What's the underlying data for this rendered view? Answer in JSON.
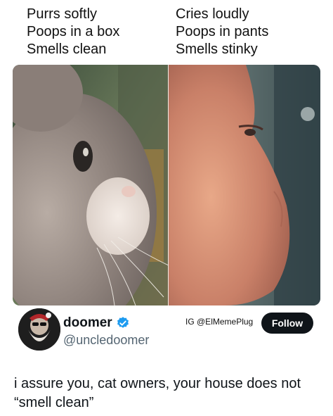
{
  "meme": {
    "left_caption": [
      "Purrs softly",
      "Poops in a box",
      "Smells clean"
    ],
    "right_caption": [
      "Cries loudly",
      "Poops in pants",
      "Smells stinky"
    ]
  },
  "post": {
    "display_name": "doomer",
    "handle": "@uncledoomer",
    "watermark": "IG @ElMemePlug",
    "follow_label": "Follow",
    "text": "i assure you, cat owners, your house does not “smell clean”"
  },
  "colors": {
    "follow_bg": "#0f1419",
    "verified": "#1d9bf0",
    "handle": "#536471"
  },
  "icons": {
    "verified": "verified-badge-icon",
    "avatar": "bearded-avatar-icon"
  }
}
